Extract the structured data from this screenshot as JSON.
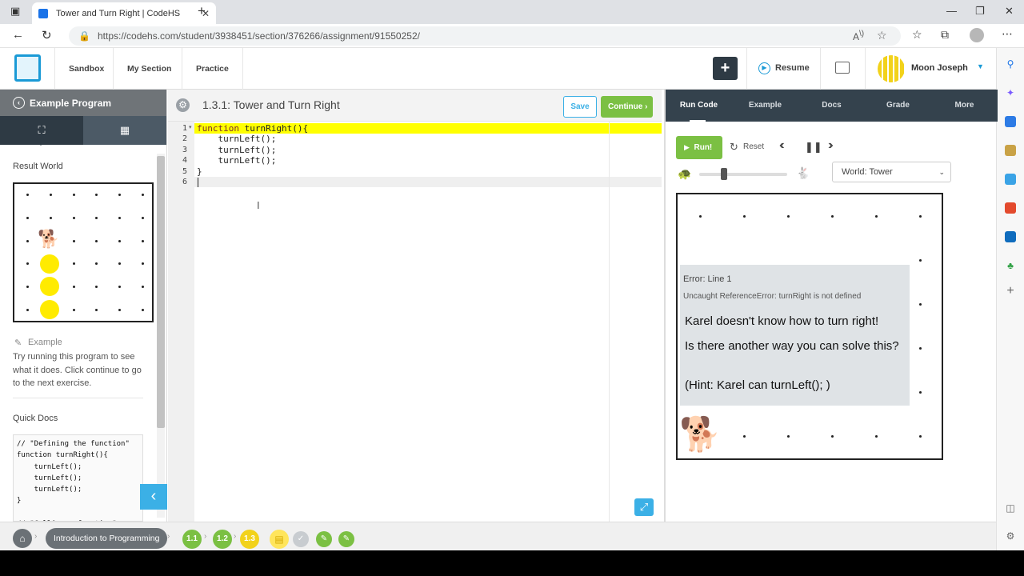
{
  "browser": {
    "tab_title": "Tower and Turn Right | CodeHS",
    "new_tab": "+",
    "url": "https://codehs.com/student/3938451/section/376266/assignment/91550252/"
  },
  "header": {
    "nav": [
      "Sandbox",
      "My Section",
      "Practice"
    ],
    "add_label": "+",
    "resume_label": "Resume",
    "user_name": "Moon Joseph"
  },
  "left": {
    "title": "Example Program",
    "result_world_label": "Result World",
    "example_label": "Example",
    "description": "Try running this program to see what it does. Click continue to go to the next exercise.",
    "quick_docs_label": "Quick Docs",
    "quick_docs_code": "// \"Defining the function\"\nfunction turnRight(){\n    turnLeft();\n    turnLeft();\n    turnLeft();\n}\n\n// \"Calling a function\""
  },
  "editor": {
    "title": "1.3.1: Tower and Turn Right",
    "save_label": "Save",
    "continue_label": "Continue",
    "line_numbers": [
      "1",
      "2",
      "3",
      "4",
      "5",
      "6"
    ],
    "lines": [
      "function turnRight(){",
      "    turnLeft();",
      "    turnLeft();",
      "    turnLeft();",
      "}",
      ""
    ]
  },
  "right": {
    "tabs": [
      "Run Code",
      "Example",
      "Docs",
      "Grade",
      "More"
    ],
    "run_label": "Run!",
    "reset_label": "Reset",
    "world_select": "World: Tower",
    "error_title": "Error: Line 1",
    "error_detail": "Uncaught ReferenceError: turnRight is not defined",
    "error_message_1": "Karel doesn't know how to turn right!",
    "error_message_2": "Is there another way you can solve this?",
    "error_message_3": "(Hint: Karel can turnLeft(); )"
  },
  "bottom": {
    "course_label": "Introduction to Programming",
    "units": [
      "1.1",
      "1.2",
      "1.3"
    ]
  },
  "colors": {
    "green": "#7bc043",
    "yellow_highlight": "#ffff00",
    "dark_nav": "#34424d",
    "tennis_ball": "#ffeb00",
    "collapse_blue": "#3bb0e6"
  }
}
